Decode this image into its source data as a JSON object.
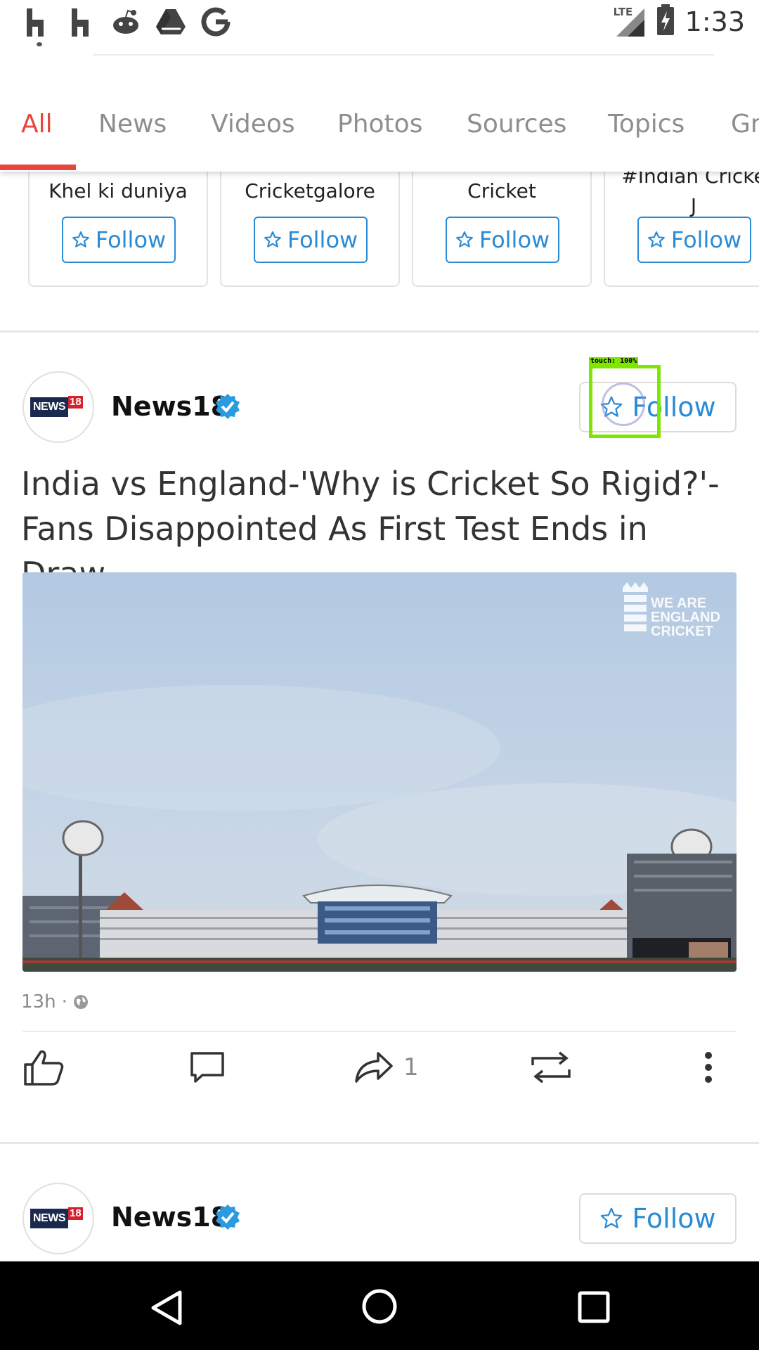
{
  "status_bar": {
    "time": "1:33",
    "network": "LTE",
    "notification_icons": [
      "houzz-icon",
      "houzz-icon",
      "reddit-icon",
      "drive-icon",
      "google-icon"
    ]
  },
  "tabs": [
    {
      "label": "All",
      "active": true
    },
    {
      "label": "News"
    },
    {
      "label": "Videos"
    },
    {
      "label": "Photos"
    },
    {
      "label": "Sources"
    },
    {
      "label": "Topics"
    },
    {
      "label": "Gr"
    }
  ],
  "suggestions": [
    {
      "name": "Khel ki duniya",
      "follow_label": "Follow"
    },
    {
      "name": "Cricketgalore",
      "follow_label": "Follow"
    },
    {
      "name": "Cricket",
      "follow_label": "Follow"
    },
    {
      "name": "#Indian Cricke\nJ",
      "follow_label": "Follow"
    }
  ],
  "post": {
    "source": "News18",
    "logo_text": "NEWS",
    "logo_number": "18",
    "follow_label": "Follow",
    "headline": "India vs England-'Why is Cricket So Rigid?'-Fans Disappointed As First Test Ends in Draw",
    "image_watermark": "WE ARE ENGLAND CRICKET",
    "time_ago": "13h",
    "separator": "·",
    "share_count": "1"
  },
  "next_post": {
    "source": "News18",
    "logo_text": "NEWS",
    "logo_number": "18",
    "follow_label": "Follow"
  },
  "touch_overlay": {
    "label": "touch: 100%"
  },
  "colors": {
    "accent": "#e6463d",
    "link": "#2a8bd5",
    "verified": "#2a9be0"
  }
}
